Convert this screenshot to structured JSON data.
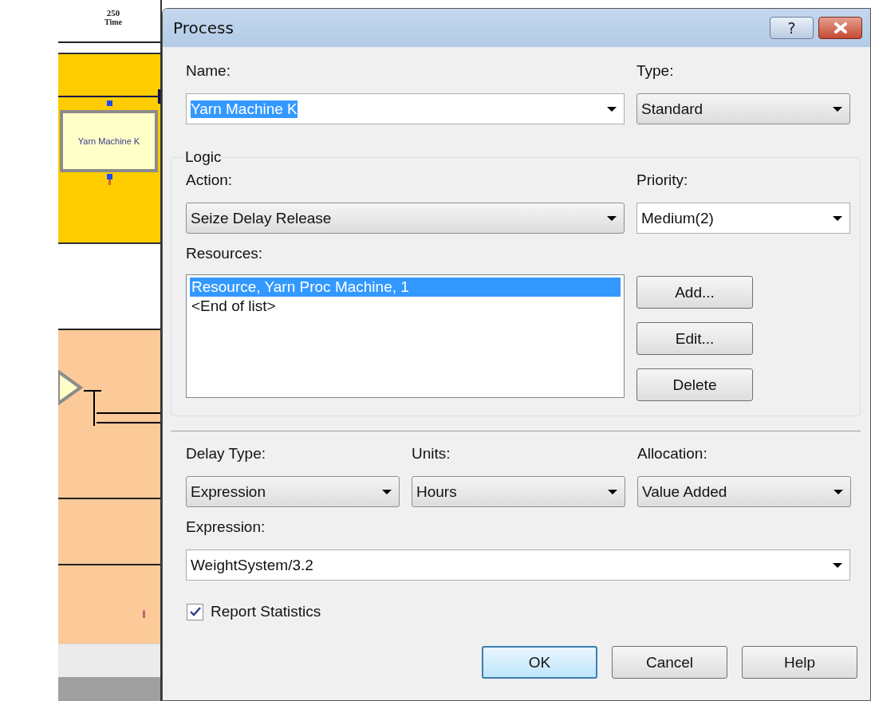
{
  "canvas": {
    "axis_label": "250",
    "axis_title": "Time",
    "process_block": {
      "label": "Yarn Machine K",
      "selected": true
    }
  },
  "dialog": {
    "title": "Process",
    "help_button": {
      "label": "?"
    },
    "name": {
      "label": "Name:",
      "kind": "combo",
      "value": "Yarn Machine K",
      "text_selected": true
    },
    "type": {
      "label": "Type:",
      "kind": "dropdown",
      "value": "Standard"
    },
    "logic": {
      "title": "Logic",
      "action": {
        "label": "Action:",
        "kind": "dropdown",
        "value": "Seize Delay Release"
      },
      "priority": {
        "label": "Priority:",
        "kind": "combo",
        "value": "Medium(2)"
      },
      "resources": {
        "label": "Resources:",
        "items": [
          {
            "text": "Resource, Yarn Proc Machine, 1",
            "selected": true
          },
          {
            "text": "<End of list>",
            "selected": false
          }
        ],
        "buttons": [
          {
            "label": "Add..."
          },
          {
            "label": "Edit..."
          },
          {
            "label": "Delete"
          }
        ]
      }
    },
    "delay_type": {
      "label": "Delay Type:",
      "kind": "dropdown",
      "value": "Expression"
    },
    "units": {
      "label": "Units:",
      "kind": "dropdown",
      "value": "Hours"
    },
    "allocation": {
      "label": "Allocation:",
      "kind": "dropdown",
      "value": "Value Added"
    },
    "expression": {
      "label": "Expression:",
      "kind": "combo",
      "value": "WeightSystem/3.2"
    },
    "report_statistics": {
      "label": "Report Statistics",
      "checked": true
    },
    "buttons": [
      {
        "label": "OK",
        "default": true
      },
      {
        "label": "Cancel",
        "default": false
      },
      {
        "label": "Help",
        "default": false
      }
    ]
  }
}
